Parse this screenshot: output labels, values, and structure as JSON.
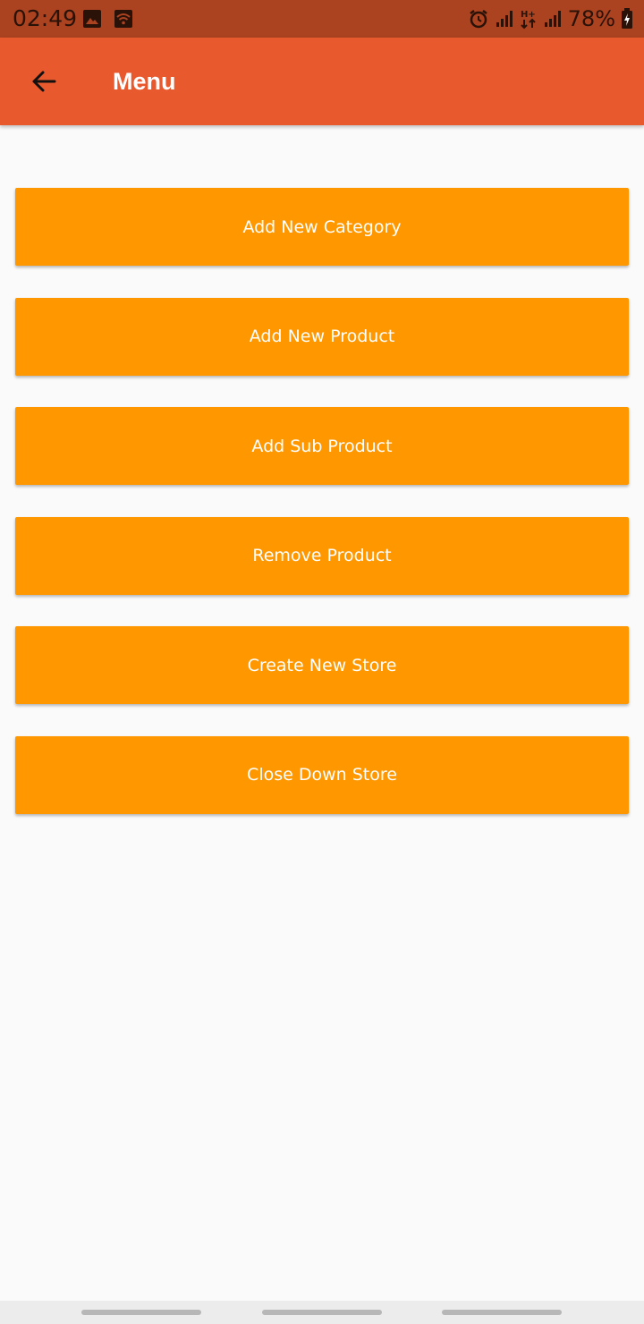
{
  "status_bar": {
    "time": "02:49",
    "battery": "78%",
    "icons": [
      "image-icon",
      "wifi-icon",
      "alarm-icon",
      "signal-icon",
      "data-arrows-icon",
      "signal-icon",
      "battery-icon"
    ]
  },
  "app_bar": {
    "title": "Menu",
    "back_icon": "arrow-back-icon",
    "color": "#e85a2e"
  },
  "menu": {
    "button_color": "#ff9800",
    "items": [
      {
        "label": "Add New Category"
      },
      {
        "label": "Add New Product"
      },
      {
        "label": "Add Sub Product"
      },
      {
        "label": "Remove Product"
      },
      {
        "label": "Create New Store"
      },
      {
        "label": "Close Down Store"
      }
    ]
  }
}
